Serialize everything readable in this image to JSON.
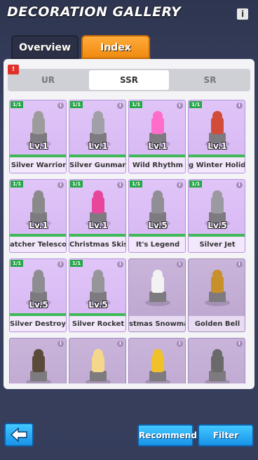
{
  "header": {
    "title": "DECORATION GALLERY",
    "info_glyph": "i"
  },
  "tabs": [
    {
      "label": "Overview"
    },
    {
      "label": "Index"
    }
  ],
  "flag_icon": "new-flag-icon",
  "rarity_tabs": [
    {
      "label": "UR"
    },
    {
      "label": "SSR"
    },
    {
      "label": "SR"
    }
  ],
  "colors": {
    "accent": "#f39a1d",
    "button": "#1fa0ef",
    "card": "#dcbff6",
    "collected": "#3fb957"
  },
  "cards": [
    {
      "name": "Silver Warrior",
      "level": "Lv.1",
      "count": "1/1",
      "icon": "silver-warrior-statue"
    },
    {
      "name": "Silver Gunman",
      "level": "Lv.1",
      "count": "1/1",
      "icon": "silver-gunman-statue"
    },
    {
      "name": "Wild Rhythm",
      "level": "Lv.1",
      "count": "1/1",
      "icon": "wild-rhythm-dj"
    },
    {
      "name": "g Winter Holiday",
      "level": "Lv.1",
      "count": "1/1",
      "icon": "winter-holiday-gingerbread"
    },
    {
      "name": "atcher Telescope",
      "level": "Lv.1",
      "count": "1/1",
      "icon": "telescope"
    },
    {
      "name": "Christmas Skis",
      "level": "Lv.1",
      "count": "1/1",
      "icon": "christmas-skis"
    },
    {
      "name": "It's Legend",
      "level": "Lv.5",
      "count": "1/1",
      "icon": "legend-statue"
    },
    {
      "name": "Silver Jet",
      "level": "Lv.5",
      "count": "1/1",
      "icon": "silver-jet"
    },
    {
      "name": "Silver Destroyer",
      "level": "Lv.5",
      "count": "1/1",
      "icon": "silver-destroyer"
    },
    {
      "name": "Silver Rocket",
      "level": "Lv.5",
      "count": "1/1",
      "icon": "silver-rocket"
    },
    {
      "name": "stmas Snowman",
      "level": "",
      "count": "",
      "icon": "snowman"
    },
    {
      "name": "Golden Bell",
      "level": "",
      "count": "",
      "icon": "golden-bell"
    },
    {
      "name": "",
      "level": "",
      "count": "",
      "icon": "tire-sign"
    },
    {
      "name": "",
      "level": "",
      "count": "",
      "icon": "ice-cream"
    },
    {
      "name": "",
      "level": "",
      "count": "",
      "icon": "chick-hat"
    },
    {
      "name": "",
      "level": "",
      "count": "",
      "icon": "cauldron"
    }
  ],
  "footer": {
    "recommend": "Recommend",
    "filter": "Filter",
    "back_icon": "back-arrow-icon"
  }
}
